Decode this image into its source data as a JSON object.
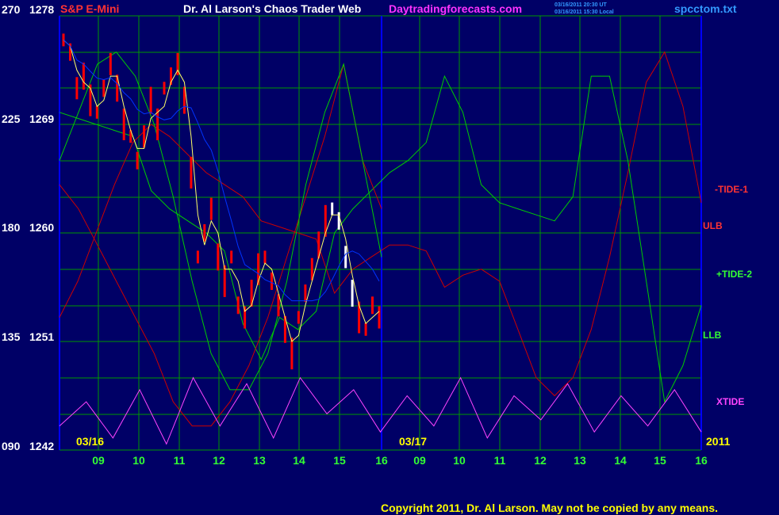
{
  "header": {
    "instrument": "S&P E-Mini",
    "title": "Dr. Al Larson's Chaos Trader Web",
    "site": "Daytradingforecasts.com",
    "timestamp_ut": "03/16/2011 20:30 UT",
    "timestamp_local": "03/16/2011 15:30 Local",
    "filename": "spcctom.txt"
  },
  "y_labels": [
    {
      "left": "270",
      "right": "1278"
    },
    {
      "left": "225",
      "right": "1269"
    },
    {
      "left": "180",
      "right": "1260"
    },
    {
      "left": "135",
      "right": "1251"
    },
    {
      "left": "090",
      "right": "1242"
    }
  ],
  "date_labels": {
    "first": "03/16",
    "second": "03/17",
    "year": "2011"
  },
  "x_ticks": [
    "09",
    "10",
    "11",
    "12",
    "13",
    "14",
    "15",
    "16",
    "09",
    "10",
    "11",
    "12",
    "13",
    "14",
    "15",
    "16"
  ],
  "series_labels": [
    {
      "text": "-TIDE-1",
      "color": "#ff3333"
    },
    {
      "text": "ULB",
      "color": "#ff3333"
    },
    {
      "text": "+TIDE-2",
      "color": "#33ff33"
    },
    {
      "text": "LLB",
      "color": "#33ff33"
    },
    {
      "text": "XTIDE",
      "color": "#ff44ff"
    }
  ],
  "copyright": "Copyright 2011, Dr. Al Larson. May not be copied by any means.",
  "colors": {
    "background": "#000066",
    "grid": "#009900",
    "frame": "#0000ff",
    "price_bars": "#ff0000",
    "recent_bars": "#ffffff",
    "fast_avg": "#ffff66",
    "slow_avg": "#0033ff",
    "ulb": "#cc0000",
    "llb": "#00cc00",
    "xtide": "#ff44ff",
    "header_red": "#ff3333",
    "header_white": "#ffffff",
    "header_magenta": "#ff33ff",
    "header_blue": "#3399ff",
    "axis_green": "#33ff33",
    "axis_yellow": "#ffff00",
    "copyright": "#ffff00"
  },
  "chart_data": {
    "type": "line",
    "title": "S&P E-Mini",
    "ylim": [
      1242,
      1278
    ],
    "grid": true,
    "series": [
      {
        "name": "ULB",
        "values": [
          1253,
          1256,
          1260,
          1264,
          1267.5,
          1269,
          1268,
          1266.5,
          1265,
          1264,
          1263,
          1261,
          1260.5,
          1260,
          1259.5,
          1255,
          1257,
          1258,
          1259,
          1259,
          1258.5,
          1255.5,
          1256.5,
          1257,
          1256,
          1252,
          1248,
          1246.5,
          1248,
          1252,
          1258,
          1265,
          1272.5,
          1275,
          1270.5,
          1262.5
        ]
      },
      {
        "name": "LLB",
        "values": [
          1270,
          1269.5,
          1269,
          1268.5,
          1268,
          1263.5,
          1262,
          1261,
          1260,
          1258.5,
          1252.5,
          1249.5,
          1253,
          1252,
          1253.5,
          1260,
          1262,
          1263.5,
          1265,
          1266,
          1267.5,
          1273,
          1270,
          1264,
          1262.5,
          1262,
          1261.5,
          1261,
          1263,
          1273,
          1273,
          1266,
          1256,
          1246,
          1249,
          1254
        ]
      },
      {
        "name": "-TIDE-1",
        "values": [
          1264,
          1262,
          1259,
          1256,
          1253,
          1250,
          1246,
          1244,
          1244,
          1246,
          1249,
          1253,
          1258,
          1263,
          1268,
          1274,
          1266,
          1262
        ]
      },
      {
        "name": "+TIDE-2",
        "values": [
          1266,
          1270,
          1274,
          1275,
          1273,
          1269,
          1263,
          1256,
          1250,
          1247,
          1247,
          1250,
          1256,
          1264,
          1270,
          1274,
          1266,
          1258
        ]
      },
      {
        "name": "XTIDE",
        "values": [
          1244,
          1246,
          1243,
          1247,
          1242.5,
          1248,
          1244,
          1247.5,
          1243,
          1248,
          1245,
          1247,
          1243.5,
          1246.5,
          1244,
          1248,
          1243,
          1246.5,
          1244.5,
          1247.5,
          1243.5,
          1246.5,
          1244,
          1247,
          1243.5
        ]
      }
    ]
  }
}
